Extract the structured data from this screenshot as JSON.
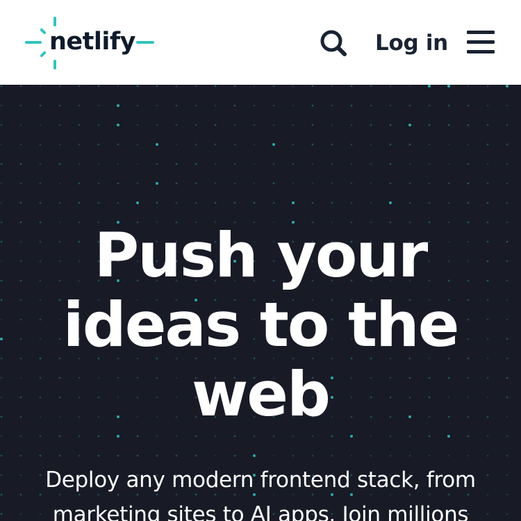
{
  "header": {
    "logo_text": "netlify",
    "search_label": "Search",
    "login_label": "Log in",
    "menu_label": "Menu"
  },
  "hero": {
    "title_lines": [
      "Push your",
      "ideas to the",
      "web"
    ],
    "subtitle_lines": [
      "Deploy any modern frontend stack, from",
      "marketing sites to AI apps. Join millions"
    ]
  },
  "colors": {
    "brand_teal": "#32c3bd",
    "hero_background": "#181a26",
    "header_background": "#ffffff",
    "text_dark": "#1a2332",
    "text_light": "#ffffff"
  },
  "icons": {
    "logo": "netlify-logo-icon",
    "search": "search-icon",
    "menu": "hamburger-menu-icon"
  }
}
